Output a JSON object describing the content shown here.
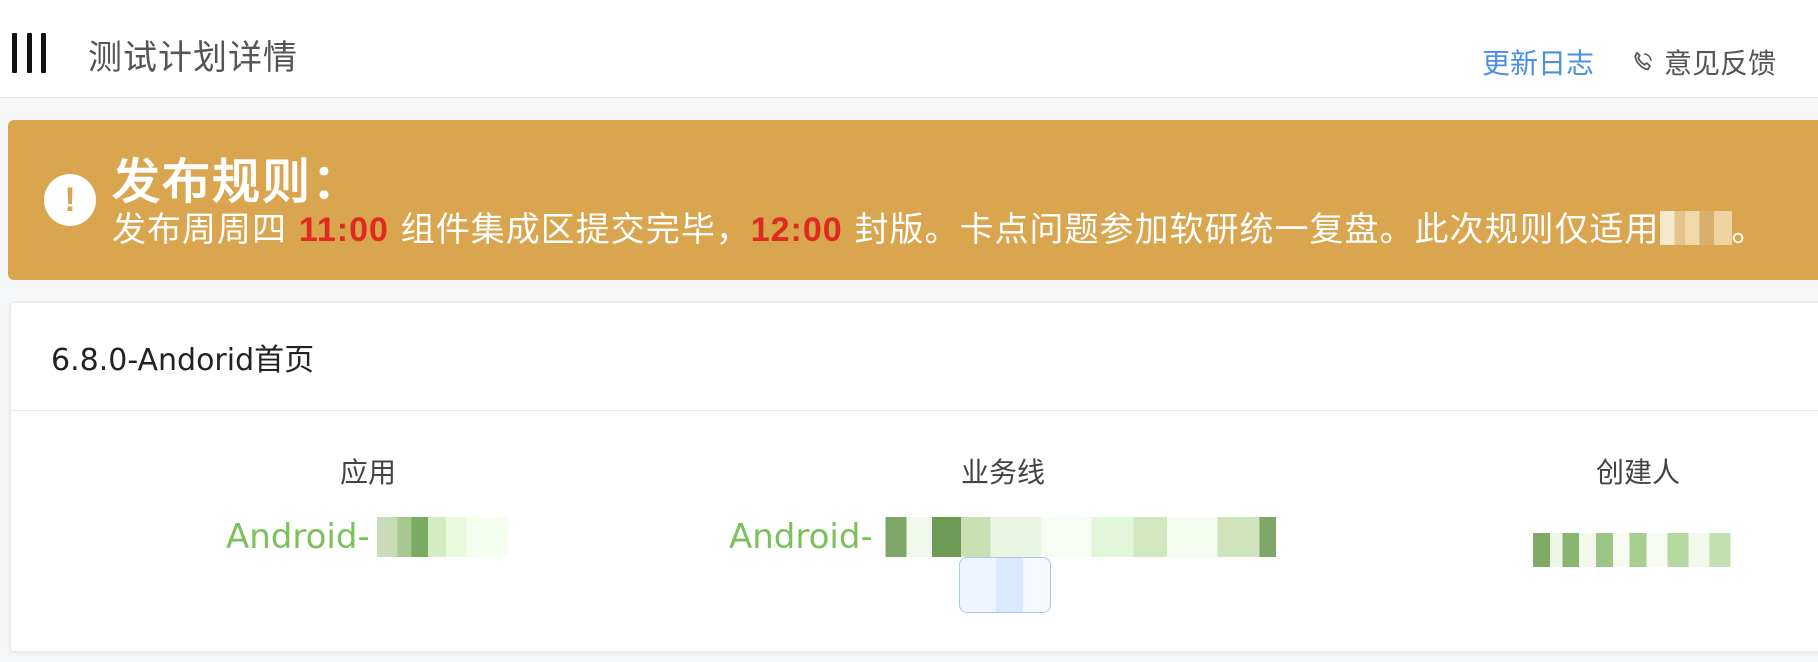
{
  "header": {
    "menu_icon": "hamburger-menu-icon",
    "title": "测试计划详情",
    "changelog_label": "更新日志",
    "feedback_icon": "phone-icon",
    "feedback_label": "意见反馈"
  },
  "banner": {
    "icon": "exclamation-icon",
    "background_color": "#daa54f",
    "title": "发布规则：",
    "text_part1": "发布周周四 ",
    "time1": "11:00",
    "text_part2": " 组件集成区提交完毕，",
    "time2": "12:00",
    "text_part3": " 封版。卡点问题参加软研统一复盘。此次规则仅适用",
    "text_end": "。"
  },
  "card": {
    "title": "6.8.0-Andorid首页",
    "fields": [
      {
        "label": "应用",
        "value_prefix": "Android-"
      },
      {
        "label": "业务线",
        "value_prefix": "Android-"
      },
      {
        "label": "创建人",
        "value_prefix": ""
      }
    ],
    "value_color": "#7bc15a"
  }
}
